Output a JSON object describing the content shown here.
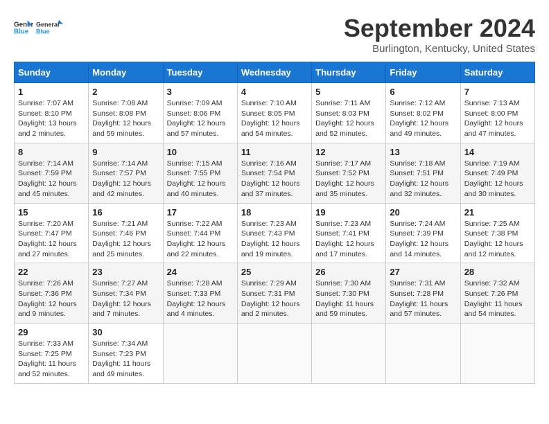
{
  "logo": {
    "line1": "General",
    "line2": "Blue"
  },
  "title": "September 2024",
  "location": "Burlington, Kentucky, United States",
  "days_of_week": [
    "Sunday",
    "Monday",
    "Tuesday",
    "Wednesday",
    "Thursday",
    "Friday",
    "Saturday"
  ],
  "weeks": [
    [
      {
        "day": "1",
        "sunrise": "7:07 AM",
        "sunset": "8:10 PM",
        "daylight": "13 hours and 2 minutes."
      },
      {
        "day": "2",
        "sunrise": "7:08 AM",
        "sunset": "8:08 PM",
        "daylight": "12 hours and 59 minutes."
      },
      {
        "day": "3",
        "sunrise": "7:09 AM",
        "sunset": "8:06 PM",
        "daylight": "12 hours and 57 minutes."
      },
      {
        "day": "4",
        "sunrise": "7:10 AM",
        "sunset": "8:05 PM",
        "daylight": "12 hours and 54 minutes."
      },
      {
        "day": "5",
        "sunrise": "7:11 AM",
        "sunset": "8:03 PM",
        "daylight": "12 hours and 52 minutes."
      },
      {
        "day": "6",
        "sunrise": "7:12 AM",
        "sunset": "8:02 PM",
        "daylight": "12 hours and 49 minutes."
      },
      {
        "day": "7",
        "sunrise": "7:13 AM",
        "sunset": "8:00 PM",
        "daylight": "12 hours and 47 minutes."
      }
    ],
    [
      {
        "day": "8",
        "sunrise": "7:14 AM",
        "sunset": "7:59 PM",
        "daylight": "12 hours and 45 minutes."
      },
      {
        "day": "9",
        "sunrise": "7:14 AM",
        "sunset": "7:57 PM",
        "daylight": "12 hours and 42 minutes."
      },
      {
        "day": "10",
        "sunrise": "7:15 AM",
        "sunset": "7:55 PM",
        "daylight": "12 hours and 40 minutes."
      },
      {
        "day": "11",
        "sunrise": "7:16 AM",
        "sunset": "7:54 PM",
        "daylight": "12 hours and 37 minutes."
      },
      {
        "day": "12",
        "sunrise": "7:17 AM",
        "sunset": "7:52 PM",
        "daylight": "12 hours and 35 minutes."
      },
      {
        "day": "13",
        "sunrise": "7:18 AM",
        "sunset": "7:51 PM",
        "daylight": "12 hours and 32 minutes."
      },
      {
        "day": "14",
        "sunrise": "7:19 AM",
        "sunset": "7:49 PM",
        "daylight": "12 hours and 30 minutes."
      }
    ],
    [
      {
        "day": "15",
        "sunrise": "7:20 AM",
        "sunset": "7:47 PM",
        "daylight": "12 hours and 27 minutes."
      },
      {
        "day": "16",
        "sunrise": "7:21 AM",
        "sunset": "7:46 PM",
        "daylight": "12 hours and 25 minutes."
      },
      {
        "day": "17",
        "sunrise": "7:22 AM",
        "sunset": "7:44 PM",
        "daylight": "12 hours and 22 minutes."
      },
      {
        "day": "18",
        "sunrise": "7:23 AM",
        "sunset": "7:43 PM",
        "daylight": "12 hours and 19 minutes."
      },
      {
        "day": "19",
        "sunrise": "7:23 AM",
        "sunset": "7:41 PM",
        "daylight": "12 hours and 17 minutes."
      },
      {
        "day": "20",
        "sunrise": "7:24 AM",
        "sunset": "7:39 PM",
        "daylight": "12 hours and 14 minutes."
      },
      {
        "day": "21",
        "sunrise": "7:25 AM",
        "sunset": "7:38 PM",
        "daylight": "12 hours and 12 minutes."
      }
    ],
    [
      {
        "day": "22",
        "sunrise": "7:26 AM",
        "sunset": "7:36 PM",
        "daylight": "12 hours and 9 minutes."
      },
      {
        "day": "23",
        "sunrise": "7:27 AM",
        "sunset": "7:34 PM",
        "daylight": "12 hours and 7 minutes."
      },
      {
        "day": "24",
        "sunrise": "7:28 AM",
        "sunset": "7:33 PM",
        "daylight": "12 hours and 4 minutes."
      },
      {
        "day": "25",
        "sunrise": "7:29 AM",
        "sunset": "7:31 PM",
        "daylight": "12 hours and 2 minutes."
      },
      {
        "day": "26",
        "sunrise": "7:30 AM",
        "sunset": "7:30 PM",
        "daylight": "11 hours and 59 minutes."
      },
      {
        "day": "27",
        "sunrise": "7:31 AM",
        "sunset": "7:28 PM",
        "daylight": "11 hours and 57 minutes."
      },
      {
        "day": "28",
        "sunrise": "7:32 AM",
        "sunset": "7:26 PM",
        "daylight": "11 hours and 54 minutes."
      }
    ],
    [
      {
        "day": "29",
        "sunrise": "7:33 AM",
        "sunset": "7:25 PM",
        "daylight": "11 hours and 52 minutes."
      },
      {
        "day": "30",
        "sunrise": "7:34 AM",
        "sunset": "7:23 PM",
        "daylight": "11 hours and 49 minutes."
      },
      null,
      null,
      null,
      null,
      null
    ]
  ]
}
